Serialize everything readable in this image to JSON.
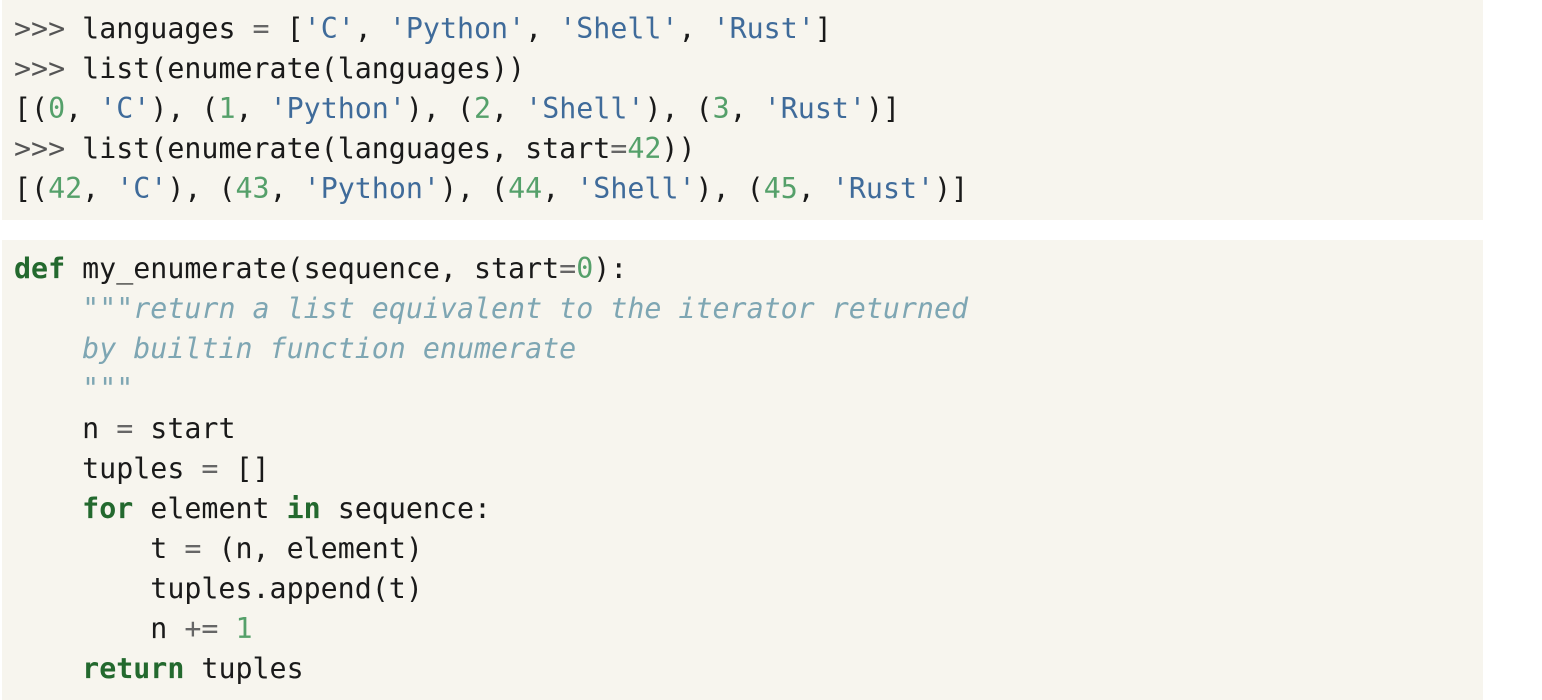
{
  "colors": {
    "background": "#f7f5ee",
    "text": "#1a1a1a",
    "prompt": "#555555",
    "operator": "#666666",
    "string": "#3f6b9a",
    "number": "#55a06a",
    "keyword": "#23692e",
    "docstring": "#7ea6b3"
  },
  "blocks": [
    {
      "name": "repl-session",
      "lines": [
        [
          [
            "prompt",
            ">>> "
          ],
          [
            "name",
            "languages "
          ],
          [
            "op",
            "="
          ],
          [
            "punct",
            " ["
          ],
          [
            "str",
            "'C'"
          ],
          [
            "punct",
            ", "
          ],
          [
            "str",
            "'Python'"
          ],
          [
            "punct",
            ", "
          ],
          [
            "str",
            "'Shell'"
          ],
          [
            "punct",
            ", "
          ],
          [
            "str",
            "'Rust'"
          ],
          [
            "punct",
            "]"
          ]
        ],
        [
          [
            "prompt",
            ">>> "
          ],
          [
            "name",
            "list(enumerate(languages))"
          ]
        ],
        [
          [
            "punct",
            "[("
          ],
          [
            "num",
            "0"
          ],
          [
            "punct",
            ", "
          ],
          [
            "str",
            "'C'"
          ],
          [
            "punct",
            "), ("
          ],
          [
            "num",
            "1"
          ],
          [
            "punct",
            ", "
          ],
          [
            "str",
            "'Python'"
          ],
          [
            "punct",
            "), ("
          ],
          [
            "num",
            "2"
          ],
          [
            "punct",
            ", "
          ],
          [
            "str",
            "'Shell'"
          ],
          [
            "punct",
            "), ("
          ],
          [
            "num",
            "3"
          ],
          [
            "punct",
            ", "
          ],
          [
            "str",
            "'Rust'"
          ],
          [
            "punct",
            ")]"
          ]
        ],
        [
          [
            "prompt",
            ">>> "
          ],
          [
            "name",
            "list(enumerate(languages, start"
          ],
          [
            "op",
            "="
          ],
          [
            "num",
            "42"
          ],
          [
            "punct",
            "))"
          ]
        ],
        [
          [
            "punct",
            "[("
          ],
          [
            "num",
            "42"
          ],
          [
            "punct",
            ", "
          ],
          [
            "str",
            "'C'"
          ],
          [
            "punct",
            "), ("
          ],
          [
            "num",
            "43"
          ],
          [
            "punct",
            ", "
          ],
          [
            "str",
            "'Python'"
          ],
          [
            "punct",
            "), ("
          ],
          [
            "num",
            "44"
          ],
          [
            "punct",
            ", "
          ],
          [
            "str",
            "'Shell'"
          ],
          [
            "punct",
            "), ("
          ],
          [
            "num",
            "45"
          ],
          [
            "punct",
            ", "
          ],
          [
            "str",
            "'Rust'"
          ],
          [
            "punct",
            ")]"
          ]
        ]
      ]
    },
    {
      "name": "function-definition",
      "lines": [
        [
          [
            "kw",
            "def"
          ],
          [
            "name",
            " my_enumerate(sequence, start"
          ],
          [
            "op",
            "="
          ],
          [
            "num",
            "0"
          ],
          [
            "punct",
            "):"
          ]
        ],
        [
          [
            "name",
            "    "
          ],
          [
            "doc",
            "\"\"\"return a list equivalent to the iterator returned"
          ]
        ],
        [
          [
            "name",
            "    "
          ],
          [
            "doc",
            "by builtin function enumerate"
          ]
        ],
        [
          [
            "name",
            "    "
          ],
          [
            "doc",
            "\"\"\""
          ]
        ],
        [
          [
            "name",
            "    n "
          ],
          [
            "op",
            "="
          ],
          [
            "name",
            " start"
          ]
        ],
        [
          [
            "name",
            "    tuples "
          ],
          [
            "op",
            "="
          ],
          [
            "punct",
            " []"
          ]
        ],
        [
          [
            "name",
            "    "
          ],
          [
            "kw",
            "for"
          ],
          [
            "name",
            " element "
          ],
          [
            "kw",
            "in"
          ],
          [
            "name",
            " sequence:"
          ]
        ],
        [
          [
            "name",
            "        t "
          ],
          [
            "op",
            "="
          ],
          [
            "punct",
            " (n, element)"
          ]
        ],
        [
          [
            "name",
            "        tuples.append(t)"
          ]
        ],
        [
          [
            "name",
            "        n "
          ],
          [
            "op",
            "+="
          ],
          [
            "name",
            " "
          ],
          [
            "num",
            "1"
          ]
        ],
        [
          [
            "name",
            "    "
          ],
          [
            "kw",
            "return"
          ],
          [
            "name",
            " tuples"
          ]
        ]
      ]
    }
  ]
}
